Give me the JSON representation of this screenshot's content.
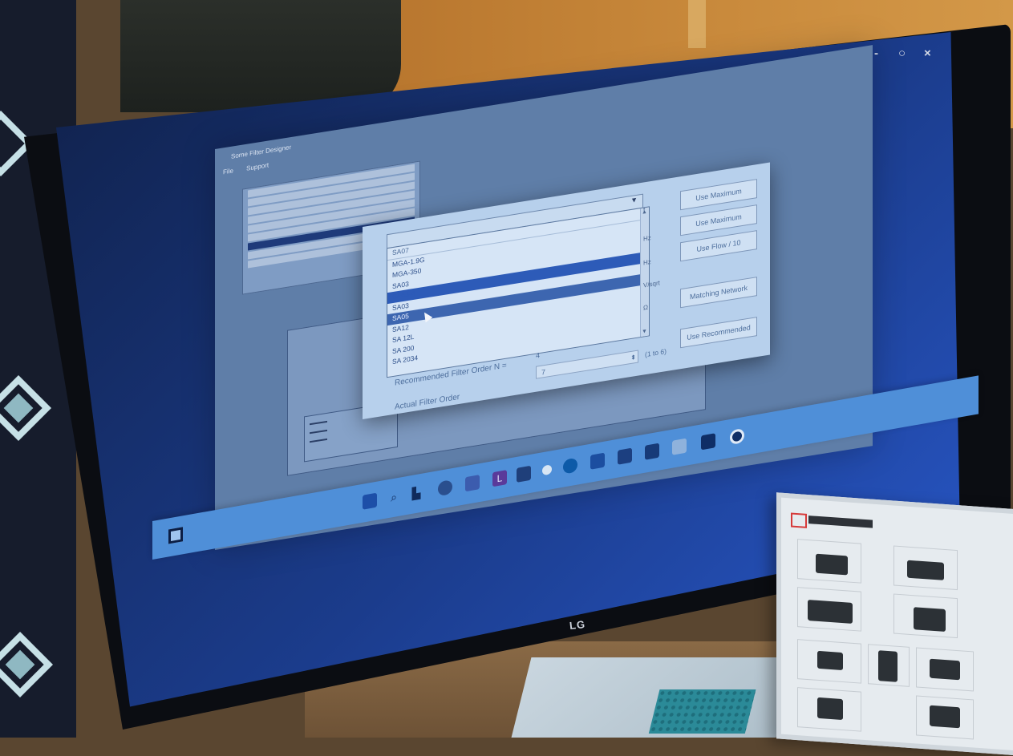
{
  "scene": {
    "monitor_brand": "LG",
    "window_controls": [
      "-",
      "○",
      "×"
    ]
  },
  "app": {
    "title": "Some Filter Designer",
    "menu": [
      "File",
      "Support"
    ]
  },
  "dialog": {
    "combo_value": "",
    "dropdown_items": [
      "SA07",
      "MGA-1.9G",
      "MGA-350",
      "SA03",
      "SA03-4",
      "SA03",
      "SA05",
      "SA12",
      "SA 12L",
      "SA 200",
      "SA 2034"
    ],
    "highlighted_index": 6,
    "cursor_item_index": 6,
    "units": [
      "f",
      "Hz",
      "Hz",
      "V/sqrt",
      "Ω"
    ],
    "buttons": {
      "use_maximum_1": "Use Maximum",
      "use_maximum_2": "Use Maximum",
      "use_flow": "Use Flow / 10",
      "matching_network": "Matching Network",
      "use_recommended": "Use Recommended"
    },
    "recommended_label": "Recommended Filter Order N =",
    "recommended_value": "4",
    "actual_label": "Actual Filter Order",
    "actual_value": "7",
    "range_note": "(1 to 6)"
  },
  "taskbar": {
    "icons": [
      "widgets-icon",
      "start-icon",
      "search-icon",
      "task-view-icon",
      "chrome-icon",
      "teams-icon",
      "app-l-icon",
      "file-icon",
      "edge-icon",
      "outlook-icon",
      "word-icon",
      "excel-icon",
      "terminal-icon",
      "powerpoint-icon",
      "settings-icon",
      "camera-icon"
    ]
  },
  "colors": {
    "screen_blue": "#1b3c8c",
    "dialog_bg": "#b7d0ec",
    "highlight": "#2d5bb8",
    "taskbar": "#4f8fd8"
  }
}
